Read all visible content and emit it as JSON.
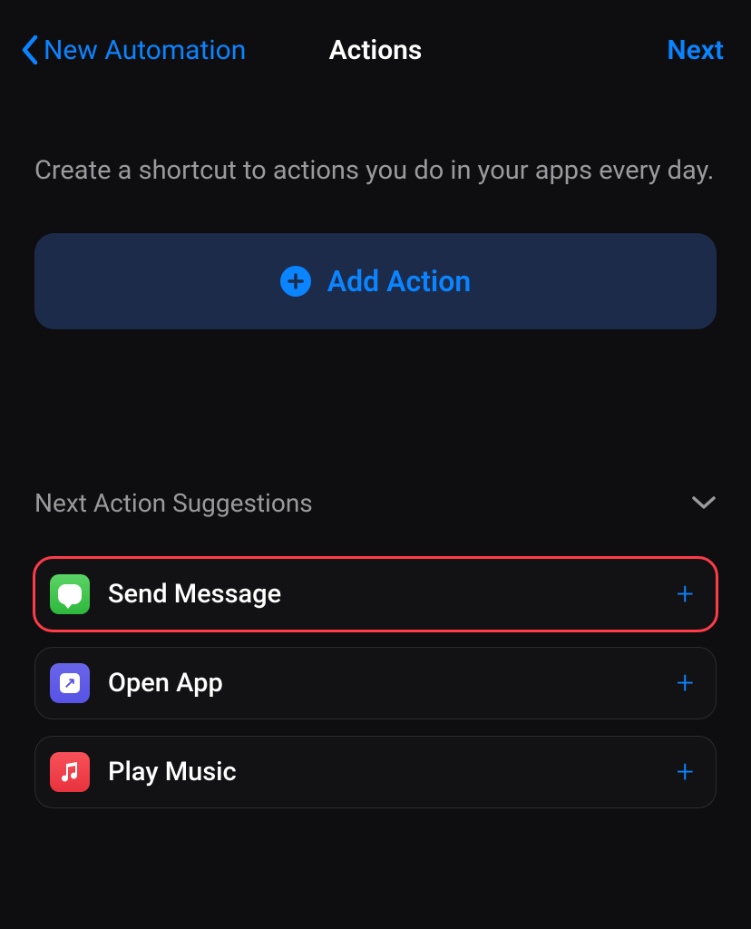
{
  "header": {
    "back_label": "New Automation",
    "title": "Actions",
    "next_label": "Next"
  },
  "description": "Create a shortcut to actions you do in your apps every day.",
  "add_action_label": "Add Action",
  "suggestions_header": "Next Action Suggestions",
  "suggestions": [
    {
      "label": "Send Message",
      "icon": "messages",
      "highlighted": true
    },
    {
      "label": "Open App",
      "icon": "openapp",
      "highlighted": false
    },
    {
      "label": "Play Music",
      "icon": "music",
      "highlighted": false
    }
  ],
  "colors": {
    "accent": "#0a84ff",
    "highlight": "#ff3b48"
  }
}
